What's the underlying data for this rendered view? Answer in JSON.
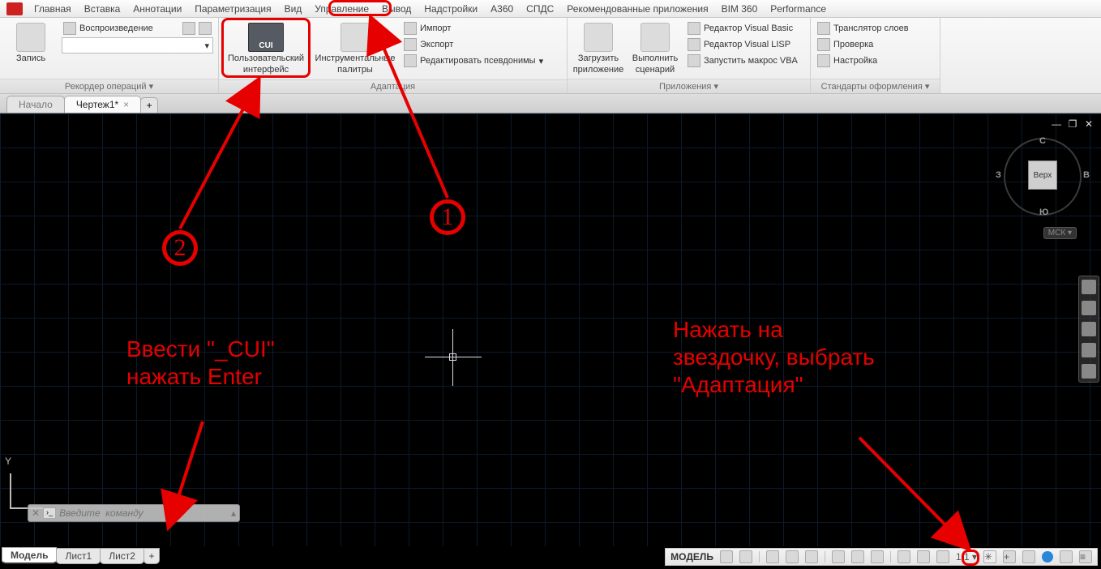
{
  "menu": {
    "items": [
      "Главная",
      "Вставка",
      "Аннотации",
      "Параметризация",
      "Вид",
      "Управление",
      "Вывод",
      "Надстройки",
      "A360",
      "СПДС",
      "Рекомендованные приложения",
      "BIM 360",
      "Performance"
    ]
  },
  "ribbon": {
    "panels": {
      "recorder": {
        "title": "Рекордер операций",
        "play": "Воспроизведение",
        "record": "Запись"
      },
      "adapt": {
        "title": "Адаптация",
        "cui_l1": "Пользовательский",
        "cui_l2": "интерфейс",
        "pal_l1": "Инструментальные",
        "pal_l2": "палитры",
        "import": "Импорт",
        "export": "Экспорт",
        "alias": "Редактировать псевдонимы"
      },
      "apps": {
        "title": "Приложения",
        "load_l1": "Загрузить",
        "load_l2": "приложение",
        "run_l1": "Выполнить",
        "run_l2": "сценарий",
        "vbasic": "Редактор Visual Basic",
        "vlisp": "Редактор Visual LISP",
        "vba": "Запустить макрос VBA"
      },
      "std": {
        "title": "Стандарты оформления",
        "layers": "Транслятор  слоев",
        "check": "Проверка",
        "config": "Настройка"
      }
    }
  },
  "doc_tabs": {
    "start": "Начало",
    "drawing": "Чертеж1*"
  },
  "viewcube": {
    "top": "Верх",
    "n": "С",
    "s": "Ю",
    "e": "В",
    "w": "З",
    "wcs": "МСК"
  },
  "ucs": {
    "y": "Y"
  },
  "cmd": {
    "placeholder": "Введите  команду"
  },
  "model_tabs": {
    "model": "Модель",
    "l1": "Лист1",
    "l2": "Лист2"
  },
  "status": {
    "space": "МОДЕЛЬ",
    "scale": "1:1"
  },
  "annotations": {
    "n1": "1",
    "n2": "2",
    "cmd_hint_l1": "Ввести \"_CUI\"",
    "cmd_hint_l2": "нажать Enter",
    "gear_hint_l1": "Нажать на",
    "gear_hint_l2": "звездочку, выбрать",
    "gear_hint_l3": "\"Адаптация\""
  }
}
